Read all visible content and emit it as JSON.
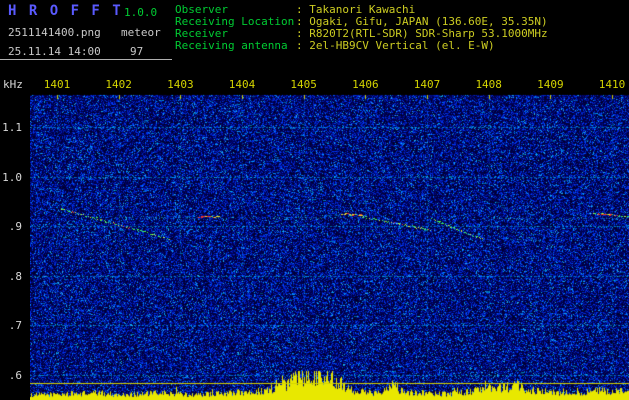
{
  "header": {
    "app_name": "H R O F F T",
    "version": "1.0.0",
    "file_name": "2511141400.png",
    "mode": "meteor",
    "timestamp": "25.11.14 14:00",
    "count": "97",
    "info": [
      {
        "label": "Observer",
        "value": ": Takanori Kawachi"
      },
      {
        "label": "Receiving Location",
        "value": ": Ogaki, Gifu, JAPAN (136.60E, 35.35N)"
      },
      {
        "label": "Receiver",
        "value": ": R820T2(RTL-SDR) SDR-Sharp 53.1000MHz"
      },
      {
        "label": "Receiving antenna",
        "value": ": 2el-HB9CV Vertical (el. E-W)"
      }
    ]
  },
  "colors": {
    "title_blue": "#5a5aff",
    "label_green": "#00cc33",
    "value_yellow": "#cccc22",
    "white_text": "#c8c8c8",
    "axis_yellow": "#d4d400",
    "axis_white": "#d8d8d8",
    "grid_cyan": "#00d8ff",
    "bars_yellow": "#e8e800",
    "noise_blue": "#2233cc"
  },
  "chart_data": {
    "type": "heatmap",
    "description": "Radio meteor echo spectrogram: 10-minute waterfall, blue speckle noise background, meteor echo traces near 0.9 kHz, yellow signal-level bars along the bottom",
    "x_tick_labels": [
      "1401",
      "1402",
      "1403",
      "1404",
      "1405",
      "1406",
      "1407",
      "1408",
      "1409",
      "1410"
    ],
    "y_axis_unit": "kHz",
    "y_tick_labels": [
      "1.1",
      "1.0",
      ".9",
      ".8",
      ".7",
      ".6"
    ],
    "y_tick_khz": [
      1.1,
      1.0,
      0.9,
      0.8,
      0.7,
      0.6
    ],
    "y_range_khz": [
      0.55,
      1.16
    ],
    "grid": true,
    "meteor_traces": [
      {
        "t_start": 0.05,
        "khz_start": 0.936,
        "t_end": 1.8,
        "khz_end": 0.875,
        "intensity": "bright"
      },
      {
        "t_start": 0.86,
        "khz_start": 0.918,
        "t_end": 4.7,
        "khz_end": 0.918,
        "intensity": "faint"
      },
      {
        "t_start": 2.3,
        "khz_start": 0.92,
        "t_end": 2.6,
        "khz_end": 0.92,
        "intensity": "red"
      },
      {
        "t_start": 4.62,
        "khz_start": 0.924,
        "t_end": 4.95,
        "khz_end": 0.923,
        "intensity": "red"
      },
      {
        "t_start": 4.95,
        "khz_start": 0.919,
        "t_end": 6.05,
        "khz_end": 0.893,
        "intensity": "bright"
      },
      {
        "t_start": 6.08,
        "khz_start": 0.914,
        "t_end": 6.88,
        "khz_end": 0.874,
        "intensity": "bright"
      },
      {
        "t_start": 7.0,
        "khz_start": 0.903,
        "t_end": 7.85,
        "khz_end": 0.87,
        "intensity": "faint"
      },
      {
        "t_start": 6.9,
        "khz_start": 0.916,
        "t_end": 9.3,
        "khz_end": 0.916,
        "intensity": "faint"
      },
      {
        "t_start": 8.66,
        "khz_start": 0.927,
        "t_end": 9.3,
        "khz_end": 0.919,
        "intensity": "bright"
      },
      {
        "t_start": 8.78,
        "khz_start": 0.925,
        "t_end": 8.97,
        "khz_end": 0.924,
        "intensity": "red"
      }
    ],
    "trace_palette": {
      "bright": [
        "#44ff55",
        "#eeff33",
        "#88ffcc",
        "#ff4433"
      ],
      "faint": [
        "#33dd99",
        "#22bbcc"
      ],
      "red": [
        "#ff3322",
        "#ffee22",
        "#66ff66"
      ]
    },
    "signal_bars_envelope": [
      [
        -0.44,
        5
      ],
      [
        0.7,
        7
      ],
      [
        1.0,
        5
      ],
      [
        1.67,
        7
      ],
      [
        2.2,
        5
      ],
      [
        2.8,
        7
      ],
      [
        3.37,
        9
      ],
      [
        3.7,
        16
      ],
      [
        3.94,
        24
      ],
      [
        4.26,
        26
      ],
      [
        4.59,
        18
      ],
      [
        4.83,
        9
      ],
      [
        5.15,
        7
      ],
      [
        5.43,
        15
      ],
      [
        5.64,
        8
      ],
      [
        6.37,
        6
      ],
      [
        7.1,
        12
      ],
      [
        7.42,
        14
      ],
      [
        7.75,
        9
      ],
      [
        8.15,
        7
      ],
      [
        8.8,
        9
      ],
      [
        9.27,
        8
      ]
    ]
  }
}
